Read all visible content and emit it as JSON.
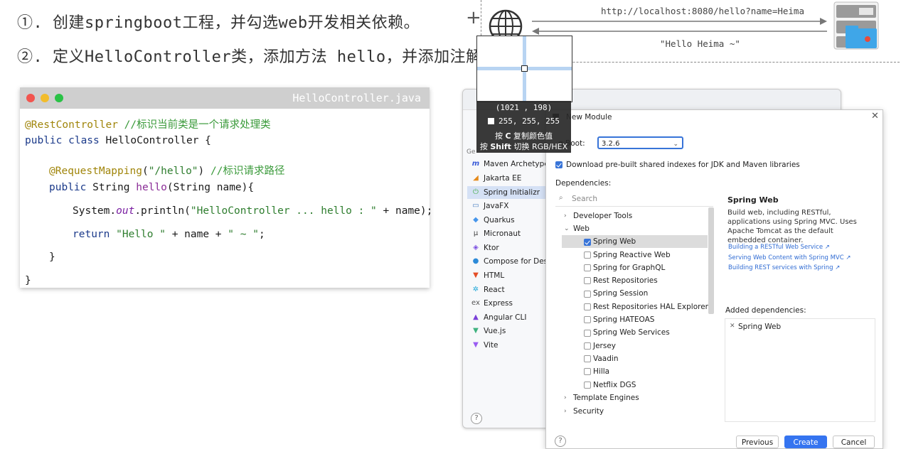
{
  "steps": [
    "①. 创建springboot工程，并勾选web开发相关依赖。",
    "②. 定义HelloController类，添加方法 hello，并添加注解。"
  ],
  "code_window": {
    "filename": "HelloController.java",
    "lines": {
      "l1_ann": "@RestController",
      "l1_comment": " //标识当前类是一个请求处理类",
      "l2_kw": "public class",
      "l2_rest": " HelloController {",
      "l3_ann": "@RequestMapping",
      "l3_open": "(",
      "l3_str": "\"/hello\"",
      "l3_close": ")",
      "l3_comment": " //标识请求路径",
      "l4_kw": "public",
      "l4_rest": " String ",
      "l4_method": "hello",
      "l4_params": "(String name){",
      "l5_a": "System.",
      "l5_out": "out",
      "l5_b": ".println(",
      "l5_str": "\"HelloController ... hello : \"",
      "l5_c": " + name);",
      "l6_kw": "return",
      "l6_s1": " \"Hello \"",
      "l6_mid": " + name + ",
      "l6_s2": "\" ~ \"",
      "l6_end": ";",
      "l7": "}",
      "l8": "}"
    }
  },
  "network": {
    "request_url": "http://localhost:8080/hello?name=Heima",
    "response": "\"Hello Heima ~\""
  },
  "color_picker": {
    "coord": "(1021 , 198)",
    "rgb": "255, 255, 255",
    "hint_copy_prefix": "按 ",
    "hint_copy_key": "C",
    "hint_copy_suffix": " 复制颜色值",
    "hint_switch_prefix": "按 ",
    "hint_switch_key": "Shift",
    "hint_switch_suffix": " 切换 RGB/HEX"
  },
  "ide": {
    "generators_label": "Ge",
    "sidebar_items": [
      {
        "label": "Maven Archetype",
        "icon": "m-icon"
      },
      {
        "label": "Jakarta EE",
        "icon": "jakarta-icon"
      },
      {
        "label": "Spring Initializr",
        "icon": "spring-icon",
        "selected": true
      },
      {
        "label": "JavaFX",
        "icon": "javafx-icon"
      },
      {
        "label": "Quarkus",
        "icon": "quarkus-icon"
      },
      {
        "label": "Micronaut",
        "icon": "mu-icon"
      },
      {
        "label": "Ktor",
        "icon": "ktor-icon"
      },
      {
        "label": "Compose for Deskt",
        "icon": "compose-icon"
      },
      {
        "label": "HTML",
        "icon": "html-icon"
      },
      {
        "label": "React",
        "icon": "react-icon"
      },
      {
        "label": "Express",
        "icon": "ex-icon"
      },
      {
        "label": "Angular CLI",
        "icon": "angular-icon"
      },
      {
        "label": "Vue.js",
        "icon": "vue-icon"
      },
      {
        "label": "Vite",
        "icon": "vite-icon"
      }
    ],
    "dialog": {
      "title": "New Module",
      "boot_label": "g Boot:",
      "boot_version": "3.2.6",
      "download_label": "Download pre-built shared indexes for JDK and Maven libraries",
      "dependencies_label": "Dependencies:",
      "search_placeholder": "Search",
      "tree": {
        "developer_tools": "Developer Tools",
        "web": "Web",
        "web_items": [
          {
            "label": "Spring Web",
            "checked": true
          },
          {
            "label": "Spring Reactive Web",
            "checked": false
          },
          {
            "label": "Spring for GraphQL",
            "checked": false
          },
          {
            "label": "Rest Repositories",
            "checked": false
          },
          {
            "label": "Spring Session",
            "checked": false
          },
          {
            "label": "Rest Repositories HAL Explorer",
            "checked": false
          },
          {
            "label": "Spring HATEOAS",
            "checked": false
          },
          {
            "label": "Spring Web Services",
            "checked": false
          },
          {
            "label": "Jersey",
            "checked": false
          },
          {
            "label": "Vaadin",
            "checked": false
          },
          {
            "label": "Hilla",
            "checked": false
          },
          {
            "label": "Netflix DGS",
            "checked": false
          }
        ],
        "template_engines": "Template Engines",
        "security": "Security"
      },
      "info": {
        "title": "Spring Web",
        "description": "Build web, including RESTful, applications using Spring MVC. Uses Apache Tomcat as the default embedded container.",
        "links": [
          "Building a RESTful Web Service ↗",
          "Serving Web Content with Spring MVC ↗",
          "Building REST services with Spring ↗"
        ]
      },
      "added_label": "Added dependencies:",
      "added_items": [
        "Spring Web"
      ],
      "buttons": {
        "previous": "Previous",
        "create": "Create",
        "cancel": "Cancel"
      },
      "help": "?"
    }
  },
  "colors": {
    "accent": "#3574f0",
    "annotation": "#a0850a",
    "comment": "#3a9a3a",
    "keyword": "#1b3a8a"
  }
}
